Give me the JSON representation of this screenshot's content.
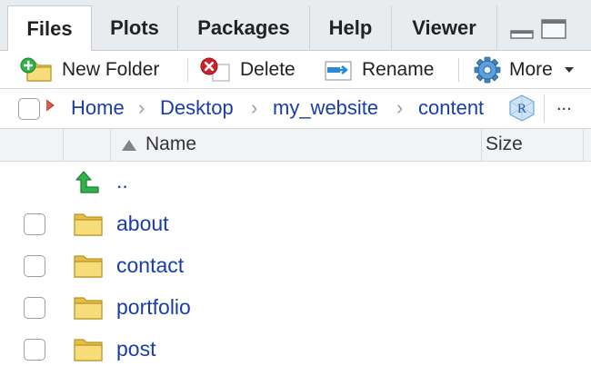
{
  "tabs": [
    {
      "label": "Files",
      "active": true
    },
    {
      "label": "Plots",
      "active": false
    },
    {
      "label": "Packages",
      "active": false
    },
    {
      "label": "Help",
      "active": false
    },
    {
      "label": "Viewer",
      "active": false
    }
  ],
  "toolbar": {
    "new_folder": "New Folder",
    "delete": "Delete",
    "rename": "Rename",
    "more": "More"
  },
  "breadcrumb": {
    "items": [
      "Home",
      "Desktop",
      "my_website",
      "content"
    ],
    "separator": "›",
    "overflow": "..."
  },
  "table": {
    "name_header": "Name",
    "size_header": "Size",
    "parent_label": "..",
    "rows": [
      {
        "name": "about",
        "type": "folder"
      },
      {
        "name": "contact",
        "type": "folder"
      },
      {
        "name": "portfolio",
        "type": "folder"
      },
      {
        "name": "post",
        "type": "folder"
      }
    ]
  },
  "colors": {
    "link": "#1a3ea8",
    "tab_bg": "#e9ecef",
    "header_bg": "#f2f3f5",
    "folder_yellow": "#f2cf5b",
    "up_arrow_green": "#2fb34a"
  }
}
